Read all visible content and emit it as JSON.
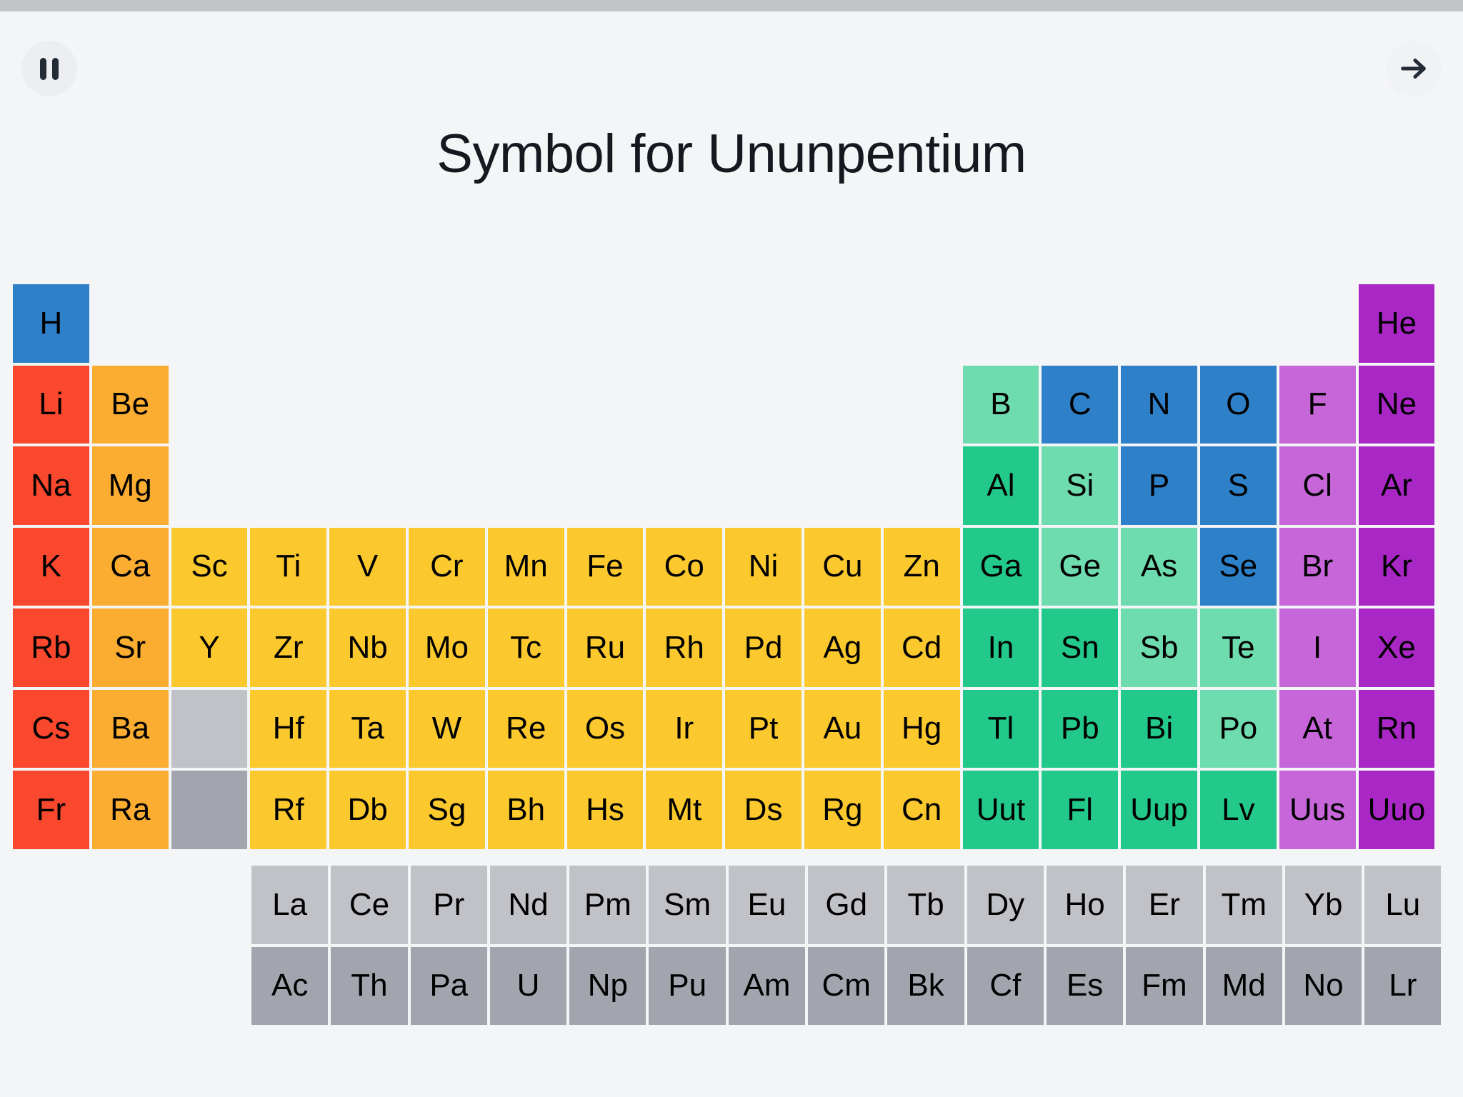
{
  "status_bar": {
    "color": "#c3c4c8"
  },
  "header": {
    "pause_button": {
      "name": "pause",
      "label": "Pause"
    },
    "next_button": {
      "name": "next",
      "label": "Next"
    }
  },
  "title": "Symbol for Ununpentium",
  "palette": {
    "background": "#f4f5f7",
    "alkali_metal": "#f9482e",
    "alkaline_earth": "#fbad32",
    "transition_metal": "#fbc92e",
    "post_transition_metal": "#22c98a",
    "metalloid": "#6fdcaf",
    "nonmetal": "#2e80c8",
    "halogen": "#c666d9",
    "noble_gas": "#a927c5",
    "lanthanide": "#c0c2c8",
    "actinide": "#a2a5ad",
    "text": "#14181f"
  },
  "periodic_table": {
    "main_rows": [
      [
        {
          "symbol": "H",
          "category": "nonmetal"
        },
        null,
        null,
        null,
        null,
        null,
        null,
        null,
        null,
        null,
        null,
        null,
        null,
        null,
        null,
        null,
        null,
        {
          "symbol": "He",
          "category": "noble"
        }
      ],
      [
        {
          "symbol": "Li",
          "category": "alkali"
        },
        {
          "symbol": "Be",
          "category": "alkaline"
        },
        null,
        null,
        null,
        null,
        null,
        null,
        null,
        null,
        null,
        null,
        {
          "symbol": "B",
          "category": "metalloid"
        },
        {
          "symbol": "C",
          "category": "nonmetal"
        },
        {
          "symbol": "N",
          "category": "nonmetal"
        },
        {
          "symbol": "O",
          "category": "nonmetal"
        },
        {
          "symbol": "F",
          "category": "halogen"
        },
        {
          "symbol": "Ne",
          "category": "noble"
        }
      ],
      [
        {
          "symbol": "Na",
          "category": "alkali"
        },
        {
          "symbol": "Mg",
          "category": "alkaline"
        },
        null,
        null,
        null,
        null,
        null,
        null,
        null,
        null,
        null,
        null,
        {
          "symbol": "Al",
          "category": "posttrans"
        },
        {
          "symbol": "Si",
          "category": "metalloid"
        },
        {
          "symbol": "P",
          "category": "nonmetal"
        },
        {
          "symbol": "S",
          "category": "nonmetal"
        },
        {
          "symbol": "Cl",
          "category": "halogen"
        },
        {
          "symbol": "Ar",
          "category": "noble"
        }
      ],
      [
        {
          "symbol": "K",
          "category": "alkali"
        },
        {
          "symbol": "Ca",
          "category": "alkaline"
        },
        {
          "symbol": "Sc",
          "category": "transition"
        },
        {
          "symbol": "Ti",
          "category": "transition"
        },
        {
          "symbol": "V",
          "category": "transition"
        },
        {
          "symbol": "Cr",
          "category": "transition"
        },
        {
          "symbol": "Mn",
          "category": "transition"
        },
        {
          "symbol": "Fe",
          "category": "transition"
        },
        {
          "symbol": "Co",
          "category": "transition"
        },
        {
          "symbol": "Ni",
          "category": "transition"
        },
        {
          "symbol": "Cu",
          "category": "transition"
        },
        {
          "symbol": "Zn",
          "category": "transition"
        },
        {
          "symbol": "Ga",
          "category": "posttrans"
        },
        {
          "symbol": "Ge",
          "category": "metalloid"
        },
        {
          "symbol": "As",
          "category": "metalloid"
        },
        {
          "symbol": "Se",
          "category": "nonmetal"
        },
        {
          "symbol": "Br",
          "category": "halogen"
        },
        {
          "symbol": "Kr",
          "category": "noble"
        }
      ],
      [
        {
          "symbol": "Rb",
          "category": "alkali"
        },
        {
          "symbol": "Sr",
          "category": "alkaline"
        },
        {
          "symbol": "Y",
          "category": "transition"
        },
        {
          "symbol": "Zr",
          "category": "transition"
        },
        {
          "symbol": "Nb",
          "category": "transition"
        },
        {
          "symbol": "Mo",
          "category": "transition"
        },
        {
          "symbol": "Tc",
          "category": "transition"
        },
        {
          "symbol": "Ru",
          "category": "transition"
        },
        {
          "symbol": "Rh",
          "category": "transition"
        },
        {
          "symbol": "Pd",
          "category": "transition"
        },
        {
          "symbol": "Ag",
          "category": "transition"
        },
        {
          "symbol": "Cd",
          "category": "transition"
        },
        {
          "symbol": "In",
          "category": "posttrans"
        },
        {
          "symbol": "Sn",
          "category": "posttrans"
        },
        {
          "symbol": "Sb",
          "category": "metalloid"
        },
        {
          "symbol": "Te",
          "category": "metalloid"
        },
        {
          "symbol": "I",
          "category": "halogen"
        },
        {
          "symbol": "Xe",
          "category": "noble"
        }
      ],
      [
        {
          "symbol": "Cs",
          "category": "alkali"
        },
        {
          "symbol": "Ba",
          "category": "alkaline"
        },
        {
          "symbol": "",
          "category": "lanthanide"
        },
        {
          "symbol": "Hf",
          "category": "transition"
        },
        {
          "symbol": "Ta",
          "category": "transition"
        },
        {
          "symbol": "W",
          "category": "transition"
        },
        {
          "symbol": "Re",
          "category": "transition"
        },
        {
          "symbol": "Os",
          "category": "transition"
        },
        {
          "symbol": "Ir",
          "category": "transition"
        },
        {
          "symbol": "Pt",
          "category": "transition"
        },
        {
          "symbol": "Au",
          "category": "transition"
        },
        {
          "symbol": "Hg",
          "category": "transition"
        },
        {
          "symbol": "Tl",
          "category": "posttrans"
        },
        {
          "symbol": "Pb",
          "category": "posttrans"
        },
        {
          "symbol": "Bi",
          "category": "posttrans"
        },
        {
          "symbol": "Po",
          "category": "metalloid"
        },
        {
          "symbol": "At",
          "category": "halogen"
        },
        {
          "symbol": "Rn",
          "category": "noble"
        }
      ],
      [
        {
          "symbol": "Fr",
          "category": "alkali"
        },
        {
          "symbol": "Ra",
          "category": "alkaline"
        },
        {
          "symbol": "",
          "category": "actinide"
        },
        {
          "symbol": "Rf",
          "category": "transition"
        },
        {
          "symbol": "Db",
          "category": "transition"
        },
        {
          "symbol": "Sg",
          "category": "transition"
        },
        {
          "symbol": "Bh",
          "category": "transition"
        },
        {
          "symbol": "Hs",
          "category": "transition"
        },
        {
          "symbol": "Mt",
          "category": "transition"
        },
        {
          "symbol": "Ds",
          "category": "transition"
        },
        {
          "symbol": "Rg",
          "category": "transition"
        },
        {
          "symbol": "Cn",
          "category": "transition"
        },
        {
          "symbol": "Uut",
          "category": "posttrans"
        },
        {
          "symbol": "Fl",
          "category": "posttrans"
        },
        {
          "symbol": "Uup",
          "category": "posttrans"
        },
        {
          "symbol": "Lv",
          "category": "posttrans"
        },
        {
          "symbol": "Uus",
          "category": "halogen"
        },
        {
          "symbol": "Uuo",
          "category": "noble"
        }
      ]
    ],
    "fblock_rows": [
      [
        {
          "symbol": "La",
          "category": "lanthanide"
        },
        {
          "symbol": "Ce",
          "category": "lanthanide"
        },
        {
          "symbol": "Pr",
          "category": "lanthanide"
        },
        {
          "symbol": "Nd",
          "category": "lanthanide"
        },
        {
          "symbol": "Pm",
          "category": "lanthanide"
        },
        {
          "symbol": "Sm",
          "category": "lanthanide"
        },
        {
          "symbol": "Eu",
          "category": "lanthanide"
        },
        {
          "symbol": "Gd",
          "category": "lanthanide"
        },
        {
          "symbol": "Tb",
          "category": "lanthanide"
        },
        {
          "symbol": "Dy",
          "category": "lanthanide"
        },
        {
          "symbol": "Ho",
          "category": "lanthanide"
        },
        {
          "symbol": "Er",
          "category": "lanthanide"
        },
        {
          "symbol": "Tm",
          "category": "lanthanide"
        },
        {
          "symbol": "Yb",
          "category": "lanthanide"
        },
        {
          "symbol": "Lu",
          "category": "lanthanide"
        }
      ],
      [
        {
          "symbol": "Ac",
          "category": "actinide"
        },
        {
          "symbol": "Th",
          "category": "actinide"
        },
        {
          "symbol": "Pa",
          "category": "actinide"
        },
        {
          "symbol": "U",
          "category": "actinide"
        },
        {
          "symbol": "Np",
          "category": "actinide"
        },
        {
          "symbol": "Pu",
          "category": "actinide"
        },
        {
          "symbol": "Am",
          "category": "actinide"
        },
        {
          "symbol": "Cm",
          "category": "actinide"
        },
        {
          "symbol": "Bk",
          "category": "actinide"
        },
        {
          "symbol": "Cf",
          "category": "actinide"
        },
        {
          "symbol": "Es",
          "category": "actinide"
        },
        {
          "symbol": "Fm",
          "category": "actinide"
        },
        {
          "symbol": "Md",
          "category": "actinide"
        },
        {
          "symbol": "No",
          "category": "actinide"
        },
        {
          "symbol": "Lr",
          "category": "actinide"
        }
      ]
    ]
  }
}
